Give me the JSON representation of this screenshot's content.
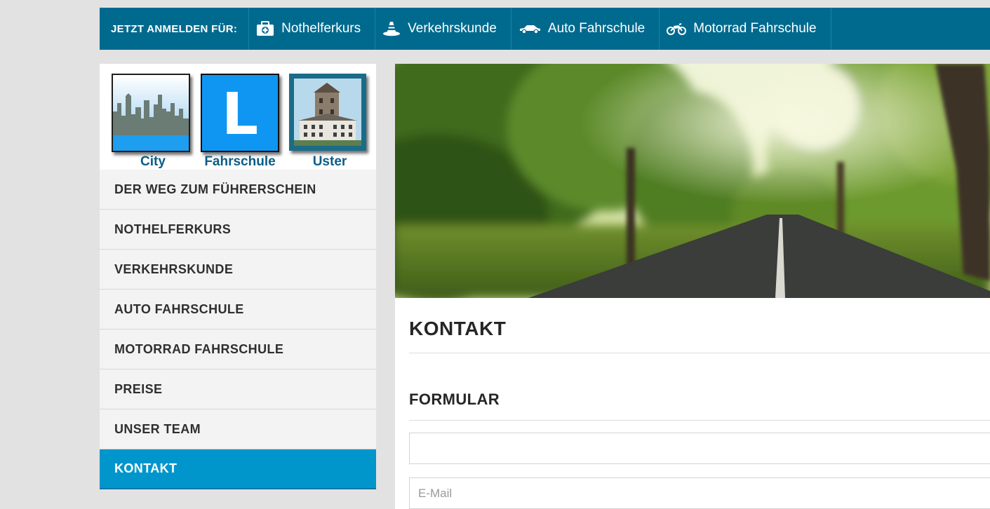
{
  "topbar": {
    "lead": "JETZT ANMELDEN FÜR:",
    "items": [
      {
        "label": "Nothelferkurs",
        "icon": "first-aid-kit-icon"
      },
      {
        "label": "Verkehrskunde",
        "icon": "traffic-cone-icon"
      },
      {
        "label": "Auto Fahrschule",
        "icon": "car-icon"
      },
      {
        "label": "Motorrad Fahrschule",
        "icon": "motorcycle-icon"
      }
    ]
  },
  "logo": {
    "city": "City",
    "fahrschule": "Fahrschule",
    "uster": "Uster",
    "learner_letter": "L"
  },
  "nav": {
    "items": [
      {
        "label": "DER WEG ZUM FÜHRERSCHEIN"
      },
      {
        "label": "NOTHELFERKURS"
      },
      {
        "label": "VERKEHRSKUNDE"
      },
      {
        "label": "AUTO FAHRSCHULE"
      },
      {
        "label": "MOTORRAD FAHRSCHULE"
      },
      {
        "label": "PREISE"
      },
      {
        "label": "UNSER TEAM"
      },
      {
        "label": "KONTAKT",
        "active": true
      }
    ]
  },
  "page": {
    "title": "KONTAKT",
    "section": "FORMULAR"
  },
  "form": {
    "name_value": "",
    "email_placeholder": "E-Mail"
  },
  "colors": {
    "topbar": "#006a8e",
    "nav_active": "#0096cc",
    "logo_text": "#0c5d86"
  }
}
